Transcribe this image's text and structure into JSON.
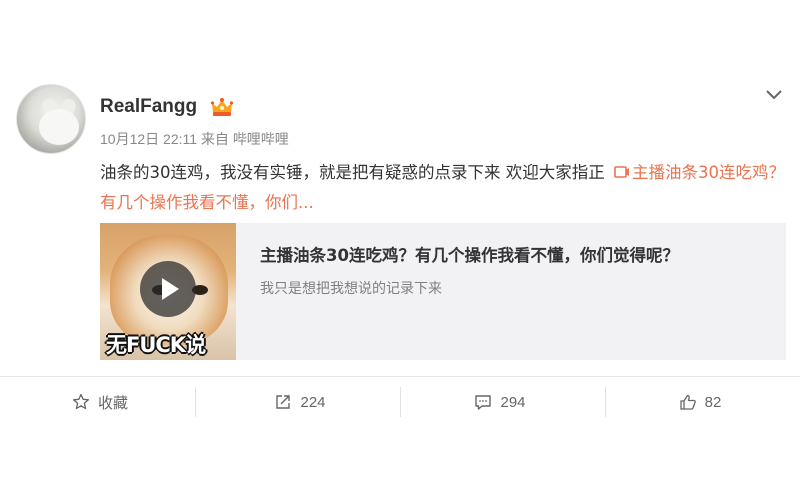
{
  "user": {
    "name": "RealFangg",
    "vip_badge_icon": "vip-crown-icon"
  },
  "meta": {
    "time": "10月12日 22:11",
    "from_label": "来自",
    "source": "哔哩哔哩"
  },
  "post": {
    "text": "油条的30连鸡，我没有实锤，就是把有疑惑的点录下来 欢迎大家指正",
    "link_icon": "video-link-icon",
    "link_text": "主播油条30连吃鸡？有几个操作我看不懂，你们..."
  },
  "card": {
    "thumbnail_caption": "无FUCK说",
    "title": "主播油条30连吃鸡？有几个操作我看不懂，你们觉得呢？",
    "description": "我只是想把我想说的记录下来"
  },
  "actions": {
    "favorite_label": "收藏",
    "repost_count": "224",
    "comment_count": "294",
    "like_count": "82"
  },
  "colors": {
    "link": "#eb7350",
    "card_bg": "#f2f2f5",
    "meta_text": "#888888"
  }
}
